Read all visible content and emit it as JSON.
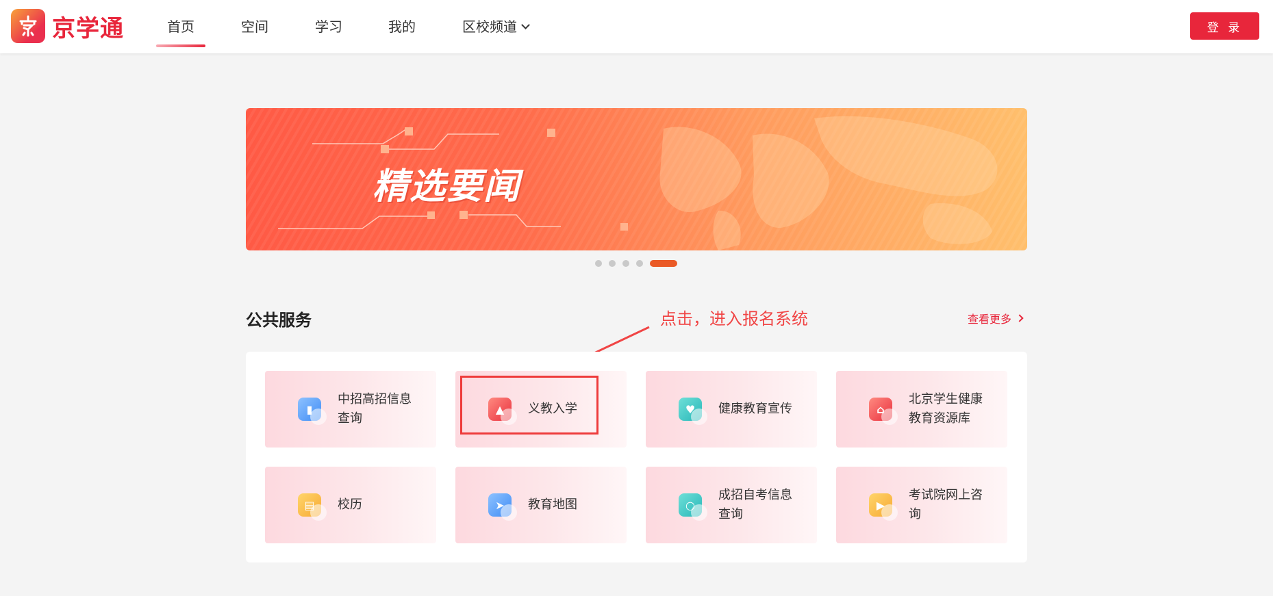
{
  "header": {
    "logo_text": "京学通",
    "nav": [
      {
        "label": "首页",
        "active": true
      },
      {
        "label": "空间"
      },
      {
        "label": "学习"
      },
      {
        "label": "我的"
      },
      {
        "label": "区校频道"
      }
    ],
    "login_label": "登 录"
  },
  "banner": {
    "title": "精选要闻",
    "slides": 5,
    "active_slide": 5
  },
  "section": {
    "title": "公共服务",
    "more_label": "查看更多",
    "annotation": "点击，进入报名系统"
  },
  "services": [
    {
      "label": "中招高招信息查询",
      "icon": "book-icon",
      "color": "#3f8cf5"
    },
    {
      "label": "义教入学",
      "icon": "graduation-cap-icon",
      "color": "#e9303e"
    },
    {
      "label": "健康教育宣传",
      "icon": "heart-pulse-icon",
      "color": "#27b6b8"
    },
    {
      "label": "北京学生健康教育资源库",
      "icon": "temple-icon",
      "color": "#e9303e"
    },
    {
      "label": "校历",
      "icon": "calendar-icon",
      "color": "#f7a933"
    },
    {
      "label": "教育地图",
      "icon": "paper-plane-icon",
      "color": "#3f8cf5"
    },
    {
      "label": "成招自考信息查询",
      "icon": "magnifier-icon",
      "color": "#27b6b8"
    },
    {
      "label": "考试院网上咨询",
      "icon": "play-icon",
      "color": "#f7a933"
    }
  ],
  "colors": {
    "brand": "#e8263b",
    "accent": "#ea5a26"
  }
}
